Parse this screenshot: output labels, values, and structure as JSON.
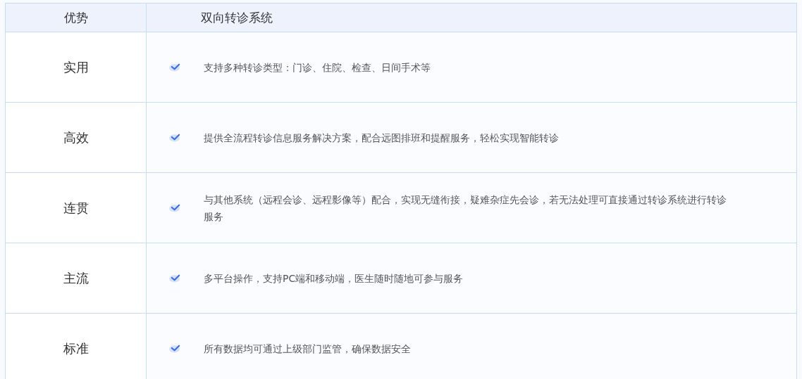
{
  "table": {
    "columns": [
      "优势",
      "双向转诊系统"
    ],
    "rows": [
      {
        "advantage": "实用",
        "description": "支持多种转诊类型：门诊、住院、检查、日间手术等"
      },
      {
        "advantage": "高效",
        "description": "提供全流程转诊信息服务解决方案，配合远图排班和提醒服务，轻松实现智能转诊"
      },
      {
        "advantage": "连贯",
        "description": "与其他系统（远程会诊、远程影像等）配合，实现无缝衔接，疑难杂症先会诊，若无法处理可直接通过转诊系统进行转诊服务"
      },
      {
        "advantage": "主流",
        "description": "多平台操作，支持PC端和移动端，医生随时随地可参与服务"
      },
      {
        "advantage": "标准",
        "description": "所有数据均可通过上级部门监管，确保数据安全"
      }
    ]
  }
}
